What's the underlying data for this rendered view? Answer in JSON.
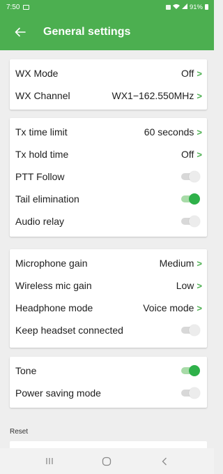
{
  "status_bar": {
    "time": "7:50",
    "battery": "91%"
  },
  "app_bar": {
    "title": "General settings"
  },
  "colors": {
    "accent": "#4caf50",
    "toggle_on": "#2fb14a",
    "background": "#eeeeee"
  },
  "section1": {
    "wx_mode": {
      "label": "WX Mode",
      "value": "Off"
    },
    "wx_channel": {
      "label": "WX Channel",
      "value": "WX1−162.550MHz"
    }
  },
  "section2": {
    "tx_time_limit": {
      "label": "Tx time limit",
      "value": "60 seconds"
    },
    "tx_hold_time": {
      "label": "Tx hold time",
      "value": "Off"
    },
    "ptt_follow": {
      "label": "PTT Follow",
      "enabled": false
    },
    "tail_elimination": {
      "label": "Tail elimination",
      "enabled": true
    },
    "audio_relay": {
      "label": "Audio relay",
      "enabled": false
    }
  },
  "section3": {
    "microphone_gain": {
      "label": "Microphone gain",
      "value": "Medium"
    },
    "wireless_mic_gain": {
      "label": "Wireless mic gain",
      "value": "Low"
    },
    "headphone_mode": {
      "label": "Headphone mode",
      "value": "Voice mode"
    },
    "keep_headset_connected": {
      "label": "Keep headset connected",
      "enabled": false
    }
  },
  "section4": {
    "tone": {
      "label": "Tone",
      "enabled": true
    },
    "power_saving_mode": {
      "label": "Power saving mode",
      "enabled": false
    }
  },
  "reset": {
    "label": "Reset"
  },
  "chevron": ">"
}
